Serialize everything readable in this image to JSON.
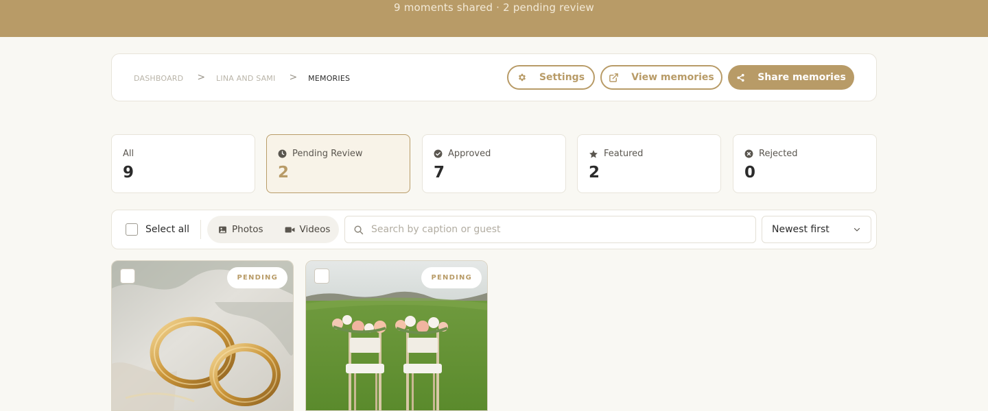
{
  "banner": {
    "subtitle": "9  moments shared · 2 pending review"
  },
  "breadcrumb": {
    "items": [
      "DASHBOARD",
      "LINA AND SAMI",
      "MEMORIES"
    ],
    "separator": ">"
  },
  "actions": {
    "settings_label": "Settings",
    "view_label": "View memories",
    "share_label": "Share memories"
  },
  "stats": [
    {
      "label": "All",
      "value": "9",
      "icon": ""
    },
    {
      "label": "Pending Review",
      "value": "2",
      "icon": "clock-icon"
    },
    {
      "label": "Approved",
      "value": "7",
      "icon": "check-circle-icon"
    },
    {
      "label": "Featured",
      "value": "2",
      "icon": "star-icon"
    },
    {
      "label": "Rejected",
      "value": "0",
      "icon": "x-circle-icon"
    }
  ],
  "toolbar": {
    "select_all_label": "Select all",
    "photos_label": "Photos",
    "videos_label": "Videos",
    "search_placeholder": "Search by caption or guest",
    "sort_value": "Newest first"
  },
  "media": [
    {
      "status": "PENDING",
      "subject": "wedding rings"
    },
    {
      "status": "PENDING",
      "subject": "decorated wedding chairs on lawn"
    }
  ],
  "colors": {
    "brand": "#b89b67",
    "background": "#f9f8f3"
  }
}
